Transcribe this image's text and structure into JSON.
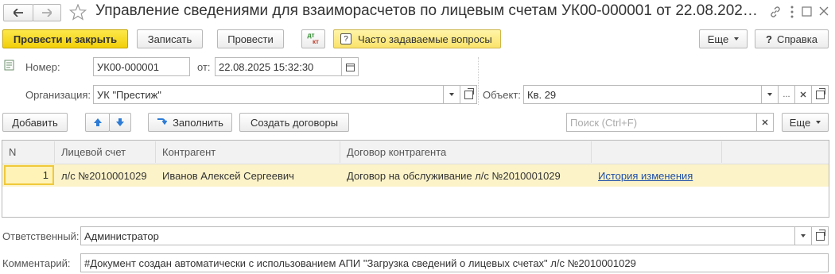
{
  "window": {
    "title": "Управление сведениями для взаиморасчетов по лицевым счетам УК00-000001 от 22.08.202…",
    "back_icon": "arrow-left",
    "forward_icon": "arrow-right",
    "star_icon": "star",
    "link_icon": "link",
    "menu_icon": "vertical-dots",
    "close_icon": "close",
    "maximize_icon": "square"
  },
  "toolbar": {
    "post_and_close": "Провести и закрыть",
    "save": "Записать",
    "post": "Провести",
    "dt_kt_top": "дт",
    "dt_kt_bottom": "кт",
    "faq": "Часто задаваемые вопросы",
    "more": "Еще",
    "help": "Справка"
  },
  "form": {
    "number_label": "Номер:",
    "number_value": "УК00-000001",
    "date_label": "от:",
    "date_value": "22.08.2025 15:32:30",
    "org_label": "Организация:",
    "org_value": "УК \"Престиж\"",
    "object_label": "Объект:",
    "object_value": "Кв. 29",
    "dots": "..."
  },
  "table_toolbar": {
    "add": "Добавить",
    "fill": "Заполнить",
    "create_contracts": "Создать договоры",
    "search_placeholder": "Поиск (Ctrl+F)",
    "more": "Еще"
  },
  "table": {
    "columns": [
      "N",
      "Лицевой счет",
      "Контрагент",
      "Договор контрагента"
    ],
    "rows": [
      {
        "n": "1",
        "account": "л/с №2010001029",
        "counterparty": "Иванов Алексей Сергеевич",
        "contract": "Договор на обслуживание л/с №2010001029",
        "link": "История изменения"
      }
    ]
  },
  "footer": {
    "responsible_label": "Ответственный:",
    "responsible_value": "Администратор",
    "comment_label": "Комментарий:",
    "comment_value": "#Документ создан автоматически с использованием АПИ \"Загрузка сведений о лицевых счетах\" л/с №2010001029"
  },
  "colors": {
    "accent_yellow": "#f5d315",
    "row_highlight": "#fcf3c9",
    "link": "#1f4fa8",
    "arrow_blue": "#2c7bd6"
  }
}
